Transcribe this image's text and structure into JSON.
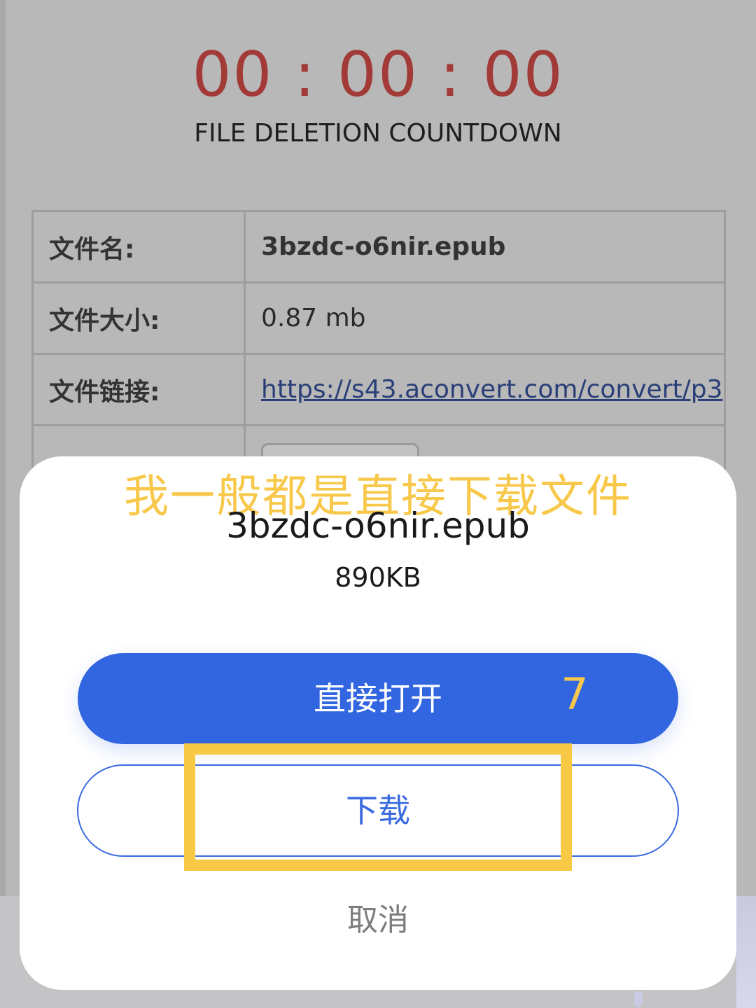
{
  "countdown": {
    "time": "00 : 00 : 00",
    "caption": "FILE DELETION COUNTDOWN"
  },
  "file_info": {
    "rows": [
      {
        "label": "文件名:",
        "value": "3bzdc-o6nir.epub"
      },
      {
        "label": "文件大小:",
        "value": "0.87 mb"
      },
      {
        "label": "文件链接:",
        "value": "https://s43.aconvert.com/convert/p3"
      }
    ]
  },
  "annotation": {
    "text": "我一般都是直接下载文件",
    "step": "7",
    "color": "#f7c944"
  },
  "sheet": {
    "file_name": "3bzdc-o6nir.epub",
    "file_size": "890KB",
    "open_button": "直接打开",
    "download_button": "下载",
    "cancel_button": "取消"
  },
  "colors": {
    "countdown": "#a23a38",
    "primary": "#3166e0",
    "cancel": "#7d7d7d"
  }
}
